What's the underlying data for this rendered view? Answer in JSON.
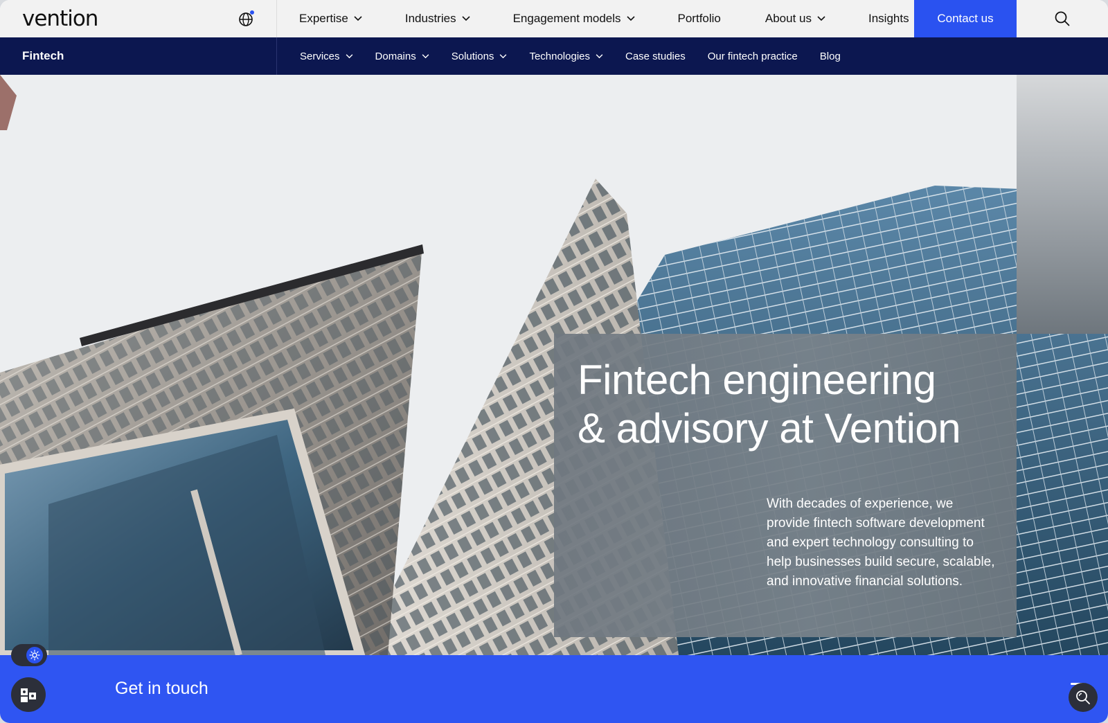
{
  "brand": {
    "logo_text": "vention"
  },
  "topnav": {
    "items": [
      {
        "label": "Expertise",
        "has_dropdown": true
      },
      {
        "label": "Industries",
        "has_dropdown": true
      },
      {
        "label": "Engagement models",
        "has_dropdown": true
      },
      {
        "label": "Portfolio",
        "has_dropdown": false
      },
      {
        "label": "About us",
        "has_dropdown": true
      },
      {
        "label": "Insights",
        "has_dropdown": false
      }
    ],
    "contact_label": "Contact us"
  },
  "subnav": {
    "section": "Fintech",
    "items": [
      {
        "label": "Services",
        "has_dropdown": true
      },
      {
        "label": "Domains",
        "has_dropdown": true
      },
      {
        "label": "Solutions",
        "has_dropdown": true
      },
      {
        "label": "Technologies",
        "has_dropdown": true
      },
      {
        "label": "Case studies",
        "has_dropdown": false
      },
      {
        "label": "Our fintech practice",
        "has_dropdown": false
      },
      {
        "label": "Blog",
        "has_dropdown": false
      }
    ]
  },
  "hero": {
    "headline_line1": "Fintech engineering",
    "headline_line2": "& advisory at Vention",
    "description": "With decades of experience, we provide fintech software development and expert technology consulting to help businesses build secure, scalable, and innovative financial solutions."
  },
  "cta": {
    "label": "Get in touch"
  },
  "icons": {
    "globe": "globe-icon",
    "search": "search-icon",
    "theme": "sun-icon",
    "widget": "puzzle-icon",
    "zoom": "zoom-icon"
  },
  "colors": {
    "accent": "#2a52f0",
    "subnav_bg": "#0c1750",
    "topbar_bg": "#f2f2f2",
    "cta_bg": "#2f55f2"
  }
}
